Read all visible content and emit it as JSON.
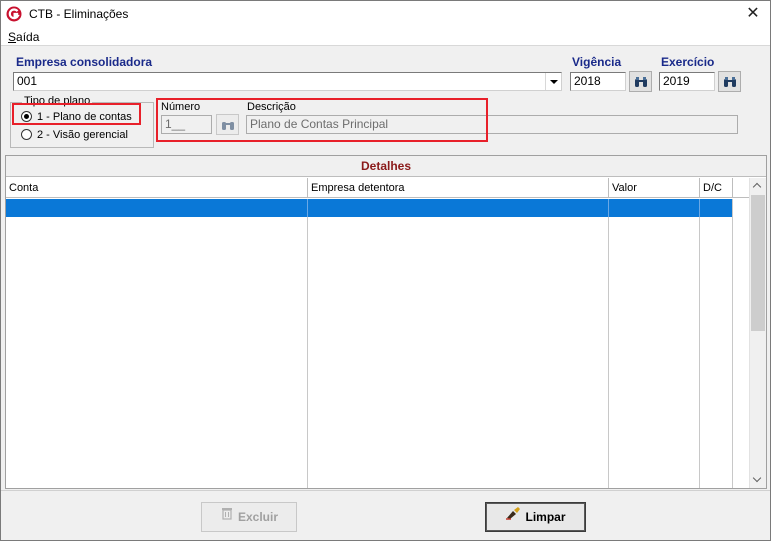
{
  "window": {
    "title": "CTB - Eliminações",
    "close_glyph": "✕"
  },
  "menu": {
    "items": [
      {
        "label": "Saída"
      }
    ]
  },
  "empresa": {
    "label": "Empresa consolidadora",
    "value": "001"
  },
  "vigencia": {
    "label": "Vigência",
    "value": "2018"
  },
  "exercicio": {
    "label": "Exercício",
    "value": "2019"
  },
  "tipo_plano": {
    "label": "Tipo de plano",
    "options": [
      {
        "label": "1 - Plano de contas",
        "checked": true
      },
      {
        "label": "2 - Visão gerencial",
        "checked": false
      }
    ]
  },
  "plano": {
    "numero_label": "Número",
    "numero_value": "1__",
    "descricao_label": "Descrição",
    "descricao_value": "Plano de Contas Principal"
  },
  "details": {
    "title": "Detalhes",
    "columns": [
      "Conta",
      "Empresa detentora",
      "Valor",
      "D/C"
    ]
  },
  "footer": {
    "excluir_label": "Excluir",
    "limpar_label": "Limpar"
  },
  "colors": {
    "accent_label": "#1a2a8a",
    "details_title": "#8b1a1a",
    "selection": "#0a78d7",
    "annotation": "#e8202a"
  }
}
